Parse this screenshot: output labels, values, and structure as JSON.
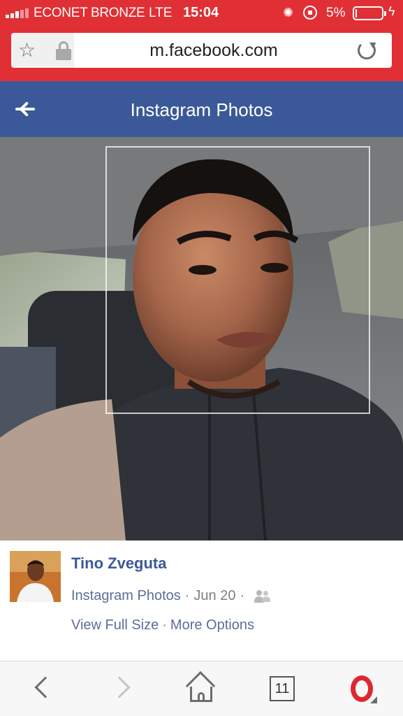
{
  "status_bar": {
    "carrier": "ECONET BRONZE",
    "network": "LTE",
    "time": "15:04",
    "battery_percent": "5%",
    "battery_level": 0.05,
    "icons": [
      "signal-icon",
      "activity-icon",
      "rotation-lock-icon",
      "battery-icon",
      "charging-bolt-icon"
    ]
  },
  "browser": {
    "url": "m.facebook.com",
    "icons": [
      "star-icon",
      "padlock-icon",
      "reload-icon"
    ]
  },
  "header": {
    "title": "Instagram Photos",
    "back_icon": "back-arrow-icon"
  },
  "post": {
    "author": "Tino Zveguta",
    "album": "Instagram Photos",
    "separator": "·",
    "date": "Jun 20",
    "privacy_icon": "friends-icon",
    "view_full_size": "View Full Size",
    "more_options": "More Options"
  },
  "toolbar": {
    "tab_count": "11",
    "icons": [
      "back-icon",
      "forward-icon",
      "home-icon",
      "tabs-icon",
      "opera-menu-icon"
    ]
  },
  "colors": {
    "browser_red": "#e02f35",
    "facebook_blue": "#3b5998",
    "link_blue": "#5b6f99",
    "meta_gray": "#7f7f7f"
  }
}
